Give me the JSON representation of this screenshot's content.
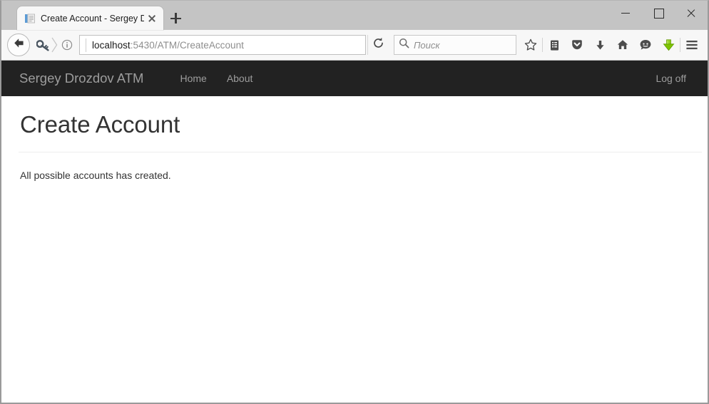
{
  "window": {
    "controls": {
      "minimize_label": "Minimize",
      "maximize_label": "Maximize",
      "close_label": "Close"
    }
  },
  "browser": {
    "tab": {
      "title": "Create Account - Sergey D...",
      "favicon": "document-icon",
      "close_label": "Close tab"
    },
    "new_tab_label": "New tab",
    "back_label": "Back",
    "identity": {
      "key_icon": "key-icon",
      "chevron_icon": "chevron-right-icon",
      "info_icon": "info-circle-icon"
    },
    "url": {
      "host": "localhost",
      "path": ":5430/ATM/CreateAccount",
      "full": "localhost:5430/ATM/CreateAccount"
    },
    "reload_label": "Reload",
    "search": {
      "placeholder": "Поиск",
      "value": "",
      "icon": "search-icon"
    },
    "toolbar_icons": [
      {
        "name": "bookmark-star-icon",
        "label": "Bookmark this page"
      },
      {
        "name": "library-icon",
        "label": "Show your library"
      },
      {
        "name": "pocket-icon",
        "label": "Save to Pocket"
      },
      {
        "name": "downloads-icon",
        "label": "Downloads"
      },
      {
        "name": "home-icon",
        "label": "Home"
      },
      {
        "name": "chat-icon",
        "label": "Chat"
      },
      {
        "name": "downthemall-icon",
        "label": "DownThemAll!",
        "color": "#7bc618"
      },
      {
        "name": "hamburger-menu-icon",
        "label": "Open menu"
      }
    ]
  },
  "site": {
    "navbar": {
      "brand": "Sergey Drozdov ATM",
      "links": [
        {
          "label": "Home"
        },
        {
          "label": "About"
        }
      ],
      "right_link": {
        "label": "Log off"
      },
      "background": "#222222",
      "text_color": "#9d9d9d"
    },
    "main": {
      "title": "Create Account",
      "message": "All possible accounts has created."
    }
  }
}
